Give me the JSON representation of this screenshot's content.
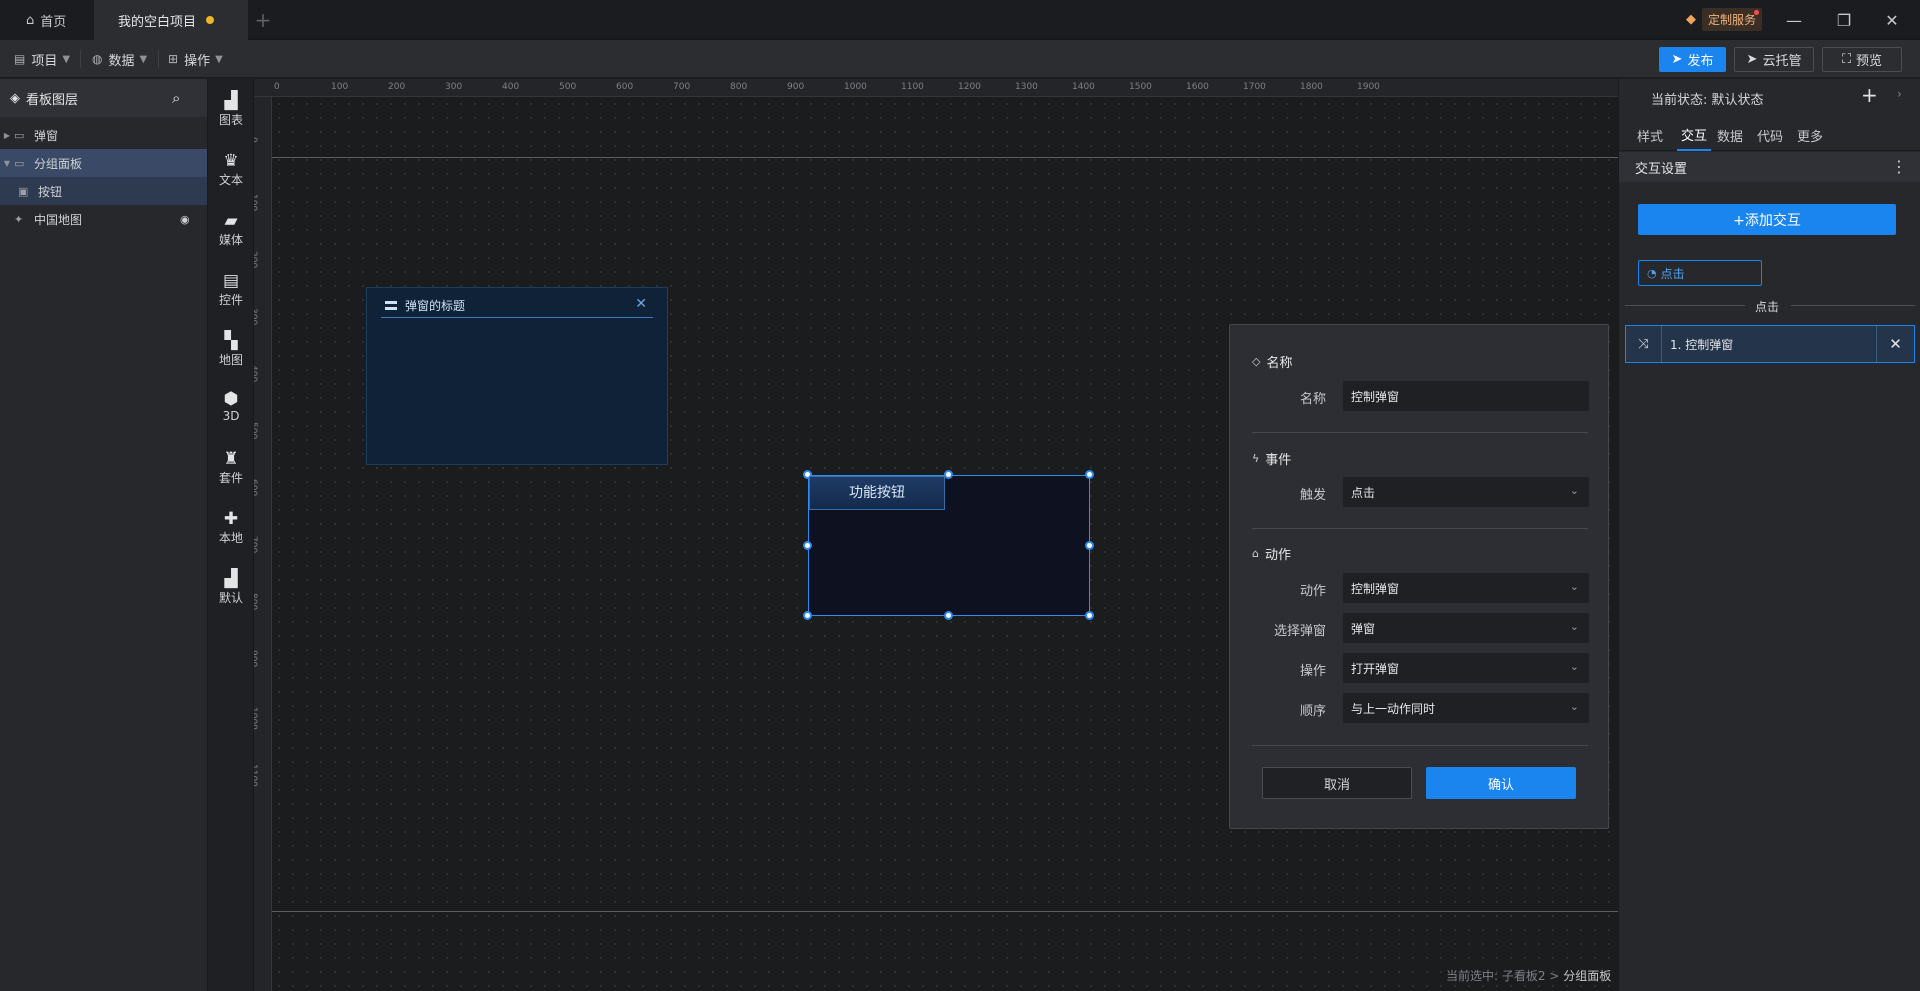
{
  "titlebar": {
    "home_tab": "首页",
    "project_tab": "我的空白项目",
    "custom_service": "定制服务"
  },
  "toolbar": {
    "menus": [
      "项目",
      "数据",
      "操作"
    ],
    "publish": "发布",
    "cloud": "云托管",
    "preview": "预览"
  },
  "layers": {
    "title": "看板图层",
    "items": [
      {
        "label": "弹窗"
      },
      {
        "label": "分组面板"
      },
      {
        "label": "按钮"
      },
      {
        "label": "中国地图"
      }
    ]
  },
  "components": [
    "图表",
    "文本",
    "媒体",
    "控件",
    "地图",
    "3D",
    "套件",
    "本地",
    "默认"
  ],
  "ruler": {
    "h": [
      "0",
      "100",
      "200",
      "300",
      "400",
      "500",
      "600",
      "700",
      "800",
      "900",
      "1000",
      "1100",
      "1200",
      "1300",
      "1400",
      "1500",
      "1600",
      "1700",
      "1800",
      "1900"
    ],
    "v": [
      "0",
      "100",
      "200",
      "300",
      "400",
      "500",
      "600",
      "700",
      "800",
      "900",
      "1000",
      "1100"
    ]
  },
  "canvas": {
    "popup_title": "弹窗的标题",
    "func_button": "功能按钮",
    "status_prefix": "当前选中: 子看板2 > ",
    "status_current": "分组面板"
  },
  "dialog": {
    "name_section": "名称",
    "name_label": "名称",
    "name_value": "控制弹窗",
    "event_section": "事件",
    "trigger_label": "触发",
    "trigger_value": "点击",
    "action_section": "动作",
    "action_label": "动作",
    "action_value": "控制弹窗",
    "select_label": "选择弹窗",
    "select_value": "弹窗",
    "op_label": "操作",
    "op_value": "打开弹窗",
    "order_label": "顺序",
    "order_value": "与上一动作同时",
    "cancel": "取消",
    "confirm": "确认"
  },
  "props": {
    "state": "当前状态:  默认状态",
    "tabs": [
      "样式",
      "交互",
      "数据",
      "代码",
      "更多"
    ],
    "section": "交互设置",
    "add_interaction": "+添加交互",
    "trigger_tag": "点击",
    "trigger_divider": "点击",
    "action_item": "1. 控制弹窗"
  },
  "colors": {
    "accent": "#1a84ef",
    "unsaved_dot": "#f0b429",
    "panel_bg": "#26282b",
    "canvas_bg": "#1b1c1e"
  }
}
